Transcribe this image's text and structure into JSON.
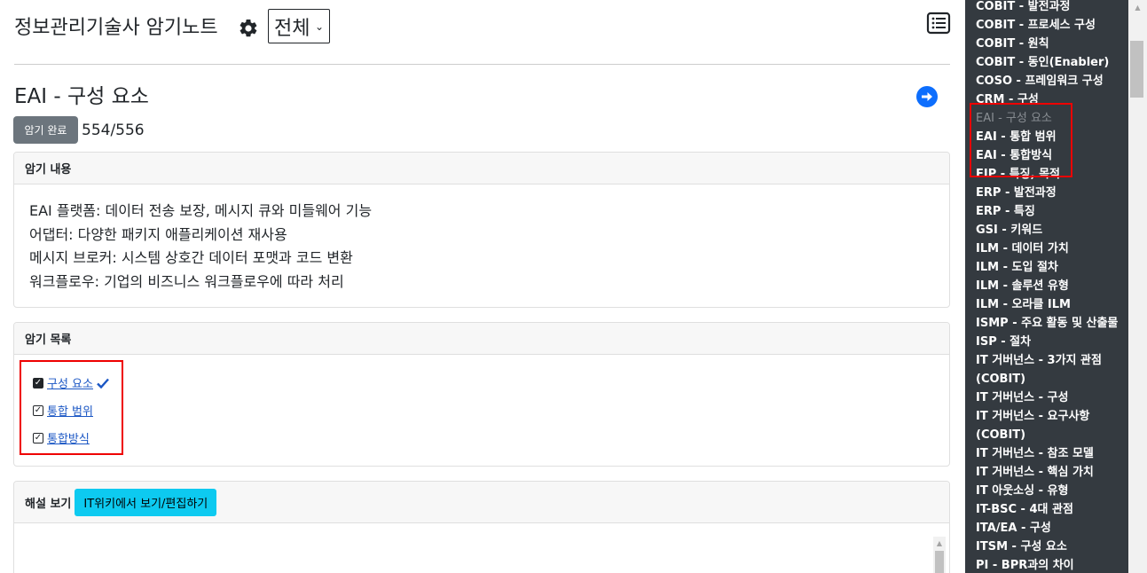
{
  "header": {
    "title": "정보관리기술사 암기노트",
    "scope_selected": "전체"
  },
  "topic": {
    "title": "EAI - 구성 요소",
    "done_label": "암기 완료",
    "progress": "554/556"
  },
  "content_card": {
    "header": "암기 내용",
    "lines": [
      "EAI 플랫폼: 데이터 전송 보장, 메시지 큐와 미들웨어 기능",
      "어댑터: 다양한 패키지 애플리케이션 재사용",
      "메시지 브로커: 시스템 상호간 데이터 포맷과 코드 변환",
      "워크플로우: 기업의 비즈니스 워크플로우에 따라 처리"
    ]
  },
  "checklist_card": {
    "header": "암기 목록",
    "items": [
      {
        "label": "구성 요소",
        "checked": true,
        "current": true
      },
      {
        "label": "통합 범위",
        "checked": true,
        "current": false
      },
      {
        "label": "통합방식",
        "checked": true,
        "current": false
      }
    ]
  },
  "explain_card": {
    "header": "해설 보기",
    "wiki_button": "IT위키에서 보기/편집하기"
  },
  "sidebar": {
    "items": [
      "COBIT - 발전과정",
      "COBIT - 프로세스 구성",
      "COBIT - 원칙",
      "COBIT - 동인(Enabler)",
      "COSO - 프레임워크 구성",
      "CRM - 구성",
      "EAI - 구성 요소",
      "EAI - 통합 범위",
      "EAI - 통합방식",
      "EIP - 특징, 목적",
      "ERP - 발전과정",
      "ERP - 특징",
      "GSI - 키워드",
      "ILM - 데이터 가치",
      "ILM - 도입 절차",
      "ILM - 솔루션 유형",
      "ILM - 오라클 ILM",
      "ISMP - 주요 활동 및 산출물",
      "ISP - 절차",
      "IT 거버넌스 - 3가지 관점 (COBIT)",
      "IT 거버넌스 - 구성",
      "IT 거버넌스 - 요구사항 (COBIT)",
      "IT 거버넌스 - 참조 모델",
      "IT 거버넌스 - 핵심 가치",
      "IT 아웃소싱 - 유형",
      "IT-BSC - 4대 관점",
      "ITA/EA - 구성",
      "ITSM - 구성 요소",
      "PI - BPR과의 차이"
    ],
    "active_index": 6
  },
  "colors": {
    "sidebar_bg": "#343a40",
    "accent_blue": "#0d6efd",
    "wiki_button": "#0dcaf0",
    "done_button": "#6c757d",
    "highlight_box": "#e00000"
  }
}
